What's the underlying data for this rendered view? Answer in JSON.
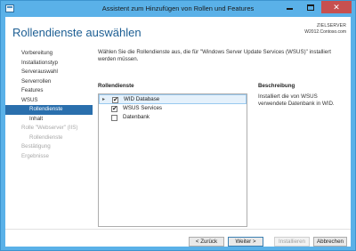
{
  "window": {
    "title": "Assistent zum Hinzufügen von Rollen und Features",
    "close_glyph": "✕"
  },
  "page": {
    "title": "Rollendienste auswählen",
    "target_label": "ZIELSERVER",
    "target_server": "W2012.Contoso.com"
  },
  "nav": {
    "items": [
      {
        "label": "Vorbereitung",
        "state": "normal"
      },
      {
        "label": "Installationstyp",
        "state": "normal"
      },
      {
        "label": "Serverauswahl",
        "state": "normal"
      },
      {
        "label": "Serverrollen",
        "state": "normal"
      },
      {
        "label": "Features",
        "state": "normal"
      },
      {
        "label": "WSUS",
        "state": "normal"
      },
      {
        "label": "Rollendienste",
        "state": "active"
      },
      {
        "label": "Inhalt",
        "state": "normal"
      },
      {
        "label": "Rolle \"Webserver\" (IIS)",
        "state": "disabled"
      },
      {
        "label": "Rollendienste",
        "state": "disabled"
      },
      {
        "label": "Bestätigung",
        "state": "disabled"
      },
      {
        "label": "Ergebnisse",
        "state": "disabled"
      }
    ]
  },
  "main": {
    "intro": "Wählen Sie die Rollendienste aus, die für \"Windows Server Update Services (WSUS)\" installiert werden müssen.",
    "roles_header": "Rollendienste",
    "description_header": "Beschreibung",
    "roles": [
      {
        "label": "WID Database",
        "checked": true,
        "selected": true,
        "check": "✔"
      },
      {
        "label": "WSUS Services",
        "checked": true,
        "selected": false,
        "check": "✔"
      },
      {
        "label": "Datenbank",
        "checked": false,
        "selected": false,
        "check": ""
      }
    ],
    "description": "Installiert die von WSUS verwendete Datenbank in WID.",
    "arrow": "▸"
  },
  "footer": {
    "back": "< Zurück",
    "next": "Weiter >",
    "install": "Installieren",
    "cancel": "Abbrechen"
  },
  "colors": {
    "window_chrome": "#5ab1e8",
    "accent": "#2a6fad",
    "title_text": "#1c5e93",
    "close_button": "#c75050"
  }
}
